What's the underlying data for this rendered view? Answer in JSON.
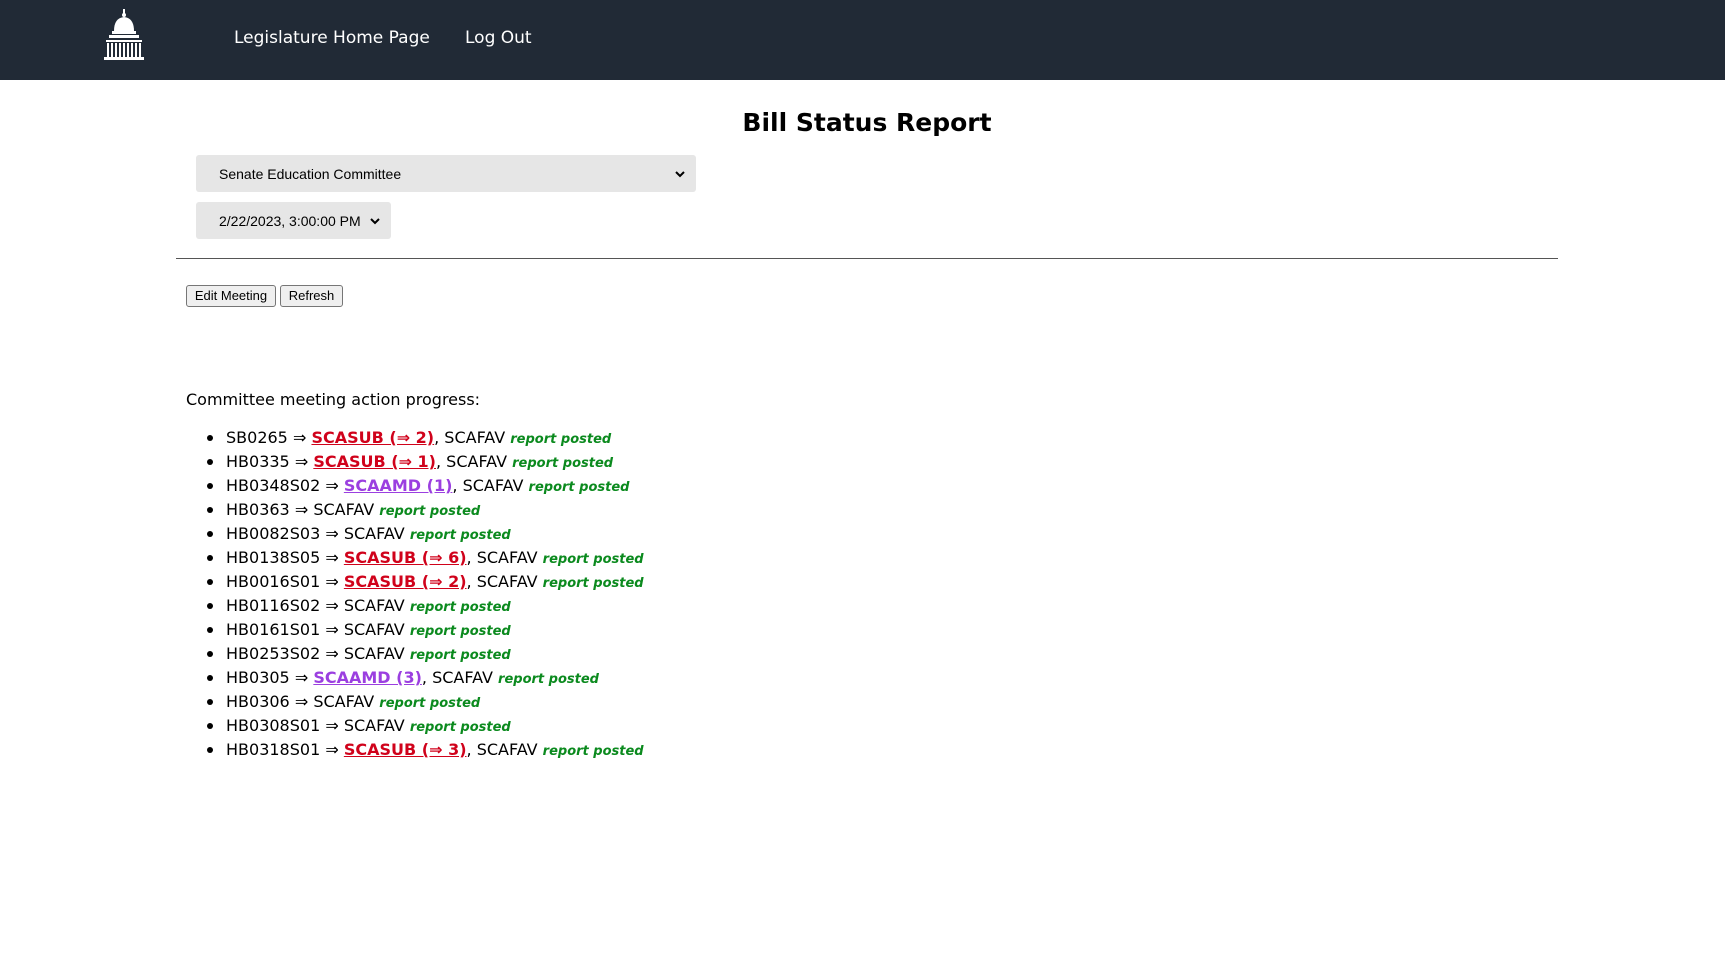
{
  "header": {
    "logo_icon": "capitol-dome-icon",
    "nav": {
      "home_label": "Legislature Home Page",
      "logout_label": "Log Out"
    },
    "bg_color": "#212a36"
  },
  "main": {
    "title": "Bill Status Report",
    "committee_select": {
      "value": "Senate Education Committee"
    },
    "meeting_select": {
      "value": "2/22/2023, 3:00:00 PM"
    },
    "buttons": {
      "edit_label": "Edit Meeting",
      "refresh_label": "Refresh"
    },
    "progress": {
      "heading": "Committee meeting action progress:",
      "arrow": "⇒",
      "items": [
        {
          "bill": "SB0265",
          "action": "SCASUB (⇒ 2)",
          "action_type": "sub",
          "tail": "SCAFAV",
          "status": "report posted"
        },
        {
          "bill": "HB0335",
          "action": "SCASUB (⇒ 1)",
          "action_type": "sub",
          "tail": "SCAFAV",
          "status": "report posted"
        },
        {
          "bill": "HB0348S02",
          "action": "SCAAMD (1)",
          "action_type": "amd",
          "tail": "SCAFAV",
          "status": "report posted"
        },
        {
          "bill": "HB0363",
          "action": "",
          "action_type": "",
          "tail": "SCAFAV",
          "status": "report posted"
        },
        {
          "bill": "HB0082S03",
          "action": "",
          "action_type": "",
          "tail": "SCAFAV",
          "status": "report posted"
        },
        {
          "bill": "HB0138S05",
          "action": "SCASUB (⇒ 6)",
          "action_type": "sub",
          "tail": "SCAFAV",
          "status": "report posted"
        },
        {
          "bill": "HB0016S01",
          "action": "SCASUB (⇒ 2)",
          "action_type": "sub",
          "tail": "SCAFAV",
          "status": "report posted"
        },
        {
          "bill": "HB0116S02",
          "action": "",
          "action_type": "",
          "tail": "SCAFAV",
          "status": "report posted"
        },
        {
          "bill": "HB0161S01",
          "action": "",
          "action_type": "",
          "tail": "SCAFAV",
          "status": "report posted"
        },
        {
          "bill": "HB0253S02",
          "action": "",
          "action_type": "",
          "tail": "SCAFAV",
          "status": "report posted"
        },
        {
          "bill": "HB0305",
          "action": "SCAAMD (3)",
          "action_type": "amd",
          "tail": "SCAFAV",
          "status": "report posted"
        },
        {
          "bill": "HB0306",
          "action": "",
          "action_type": "",
          "tail": "SCAFAV",
          "status": "report posted"
        },
        {
          "bill": "HB0308S01",
          "action": "",
          "action_type": "",
          "tail": "SCAFAV",
          "status": "report posted"
        },
        {
          "bill": "HB0318S01",
          "action": "SCASUB (⇒ 3)",
          "action_type": "sub",
          "tail": "SCAFAV",
          "status": "report posted"
        }
      ]
    }
  },
  "colors": {
    "substitute_link": "#d0021b",
    "amendment_link": "#9b3fe0",
    "status_text": "#0b8a1e"
  }
}
